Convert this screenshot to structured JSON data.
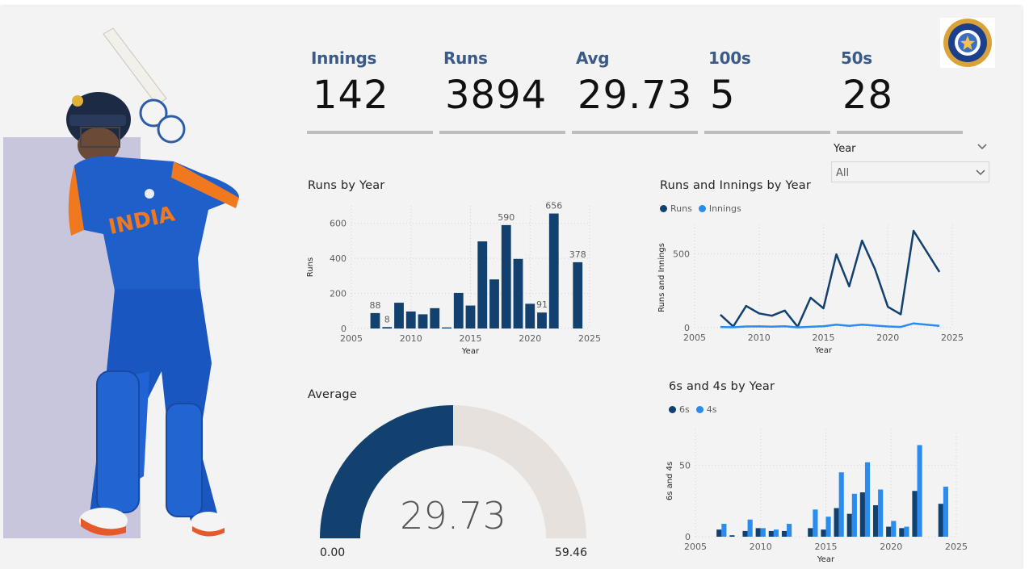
{
  "kpis": [
    {
      "label": "Innings",
      "value": "142"
    },
    {
      "label": "Runs",
      "value": "3894"
    },
    {
      "label": "Avg",
      "value": "29.73"
    },
    {
      "label": "100s",
      "value": "5"
    },
    {
      "label": "50s",
      "value": "28"
    }
  ],
  "slicer": {
    "label": "Year",
    "value": "All"
  },
  "colors": {
    "dark": "#12406f",
    "light": "#2b8cf0",
    "gauge_bg": "#e6e1dc",
    "kpi_label": "#3b5a86",
    "panel": "#c7c6dc"
  },
  "icons": [
    "chevron-down-icon",
    "bcci-logo"
  ],
  "runs_chart": {
    "title": "Runs by Year"
  },
  "line_chart": {
    "title": "Runs and Innings by Year"
  },
  "sixes_chart": {
    "title": "6s and 4s by Year"
  },
  "gauge": {
    "title": "Average",
    "value": "29.73",
    "min_label": "0.00",
    "max_label": "59.46"
  },
  "chart_data": [
    {
      "type": "bar",
      "title": "Runs by Year",
      "xlabel": "Year",
      "ylabel": "Runs",
      "x": [
        2007,
        2008,
        2009,
        2010,
        2011,
        2012,
        2013,
        2014,
        2015,
        2016,
        2017,
        2018,
        2019,
        2020,
        2021,
        2022,
        2024
      ],
      "values": [
        88,
        8,
        147,
        97,
        81,
        116,
        6,
        203,
        131,
        497,
        280,
        590,
        397,
        141,
        91,
        656,
        378
      ],
      "data_labels": {
        "2007": "88",
        "2008": "8",
        "2018": "590",
        "2021": "91",
        "2022": "656",
        "2024": "378"
      },
      "xticks": [
        "2005",
        "2010",
        "2015",
        "2020",
        "2025"
      ],
      "yticks": [
        "0",
        "200",
        "400",
        "600"
      ],
      "xlim": [
        2005,
        2025
      ],
      "ylim": [
        0,
        700
      ],
      "grid": true
    },
    {
      "type": "line",
      "title": "Runs and Innings by Year",
      "xlabel": "Year",
      "ylabel": "Runs and Innings",
      "x": [
        2007,
        2008,
        2009,
        2010,
        2011,
        2012,
        2013,
        2014,
        2015,
        2016,
        2017,
        2018,
        2019,
        2020,
        2021,
        2022,
        2024
      ],
      "series": [
        {
          "name": "Runs",
          "values": [
            88,
            8,
            147,
            97,
            81,
            116,
            6,
            203,
            131,
            497,
            280,
            590,
            397,
            141,
            91,
            656,
            378
          ]
        },
        {
          "name": "Innings",
          "values": [
            5,
            3,
            8,
            9,
            7,
            10,
            2,
            6,
            10,
            20,
            12,
            20,
            14,
            8,
            5,
            29,
            12
          ]
        }
      ],
      "xticks": [
        "2005",
        "2010",
        "2015",
        "2020",
        "2025"
      ],
      "yticks": [
        "0",
        "500"
      ],
      "xlim": [
        2005,
        2025
      ],
      "ylim": [
        0,
        700
      ],
      "legend": "top-left",
      "grid": true
    },
    {
      "type": "bar",
      "title": "6s and 4s by Year",
      "xlabel": "Year",
      "ylabel": "6s and 4s",
      "x": [
        2007,
        2008,
        2009,
        2010,
        2011,
        2012,
        2013,
        2014,
        2015,
        2016,
        2017,
        2018,
        2019,
        2020,
        2021,
        2022,
        2024
      ],
      "series": [
        {
          "name": "6s",
          "values": [
            5,
            1,
            4,
            6,
            4,
            4,
            0,
            6,
            5,
            20,
            16,
            31,
            22,
            7,
            6,
            32,
            23
          ]
        },
        {
          "name": "4s",
          "values": [
            9,
            0,
            12,
            6,
            5,
            9,
            0,
            19,
            14,
            45,
            30,
            52,
            33,
            11,
            7,
            64,
            35
          ]
        }
      ],
      "xticks": [
        "2005",
        "2010",
        "2015",
        "2020",
        "2025"
      ],
      "yticks": [
        "0",
        "50"
      ],
      "xlim": [
        2005,
        2025
      ],
      "ylim": [
        0,
        75
      ],
      "legend": "top-left",
      "grid": true
    }
  ]
}
